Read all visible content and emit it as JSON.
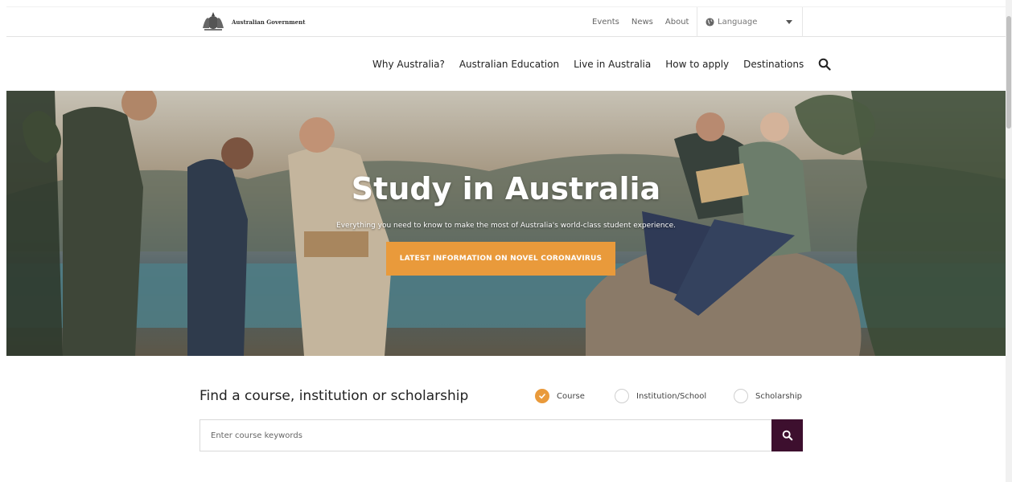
{
  "topbar": {
    "gov_name": "Australian Government",
    "links": [
      "Events",
      "News",
      "About"
    ],
    "language_label": "Language"
  },
  "nav": {
    "items": [
      "Why Australia?",
      "Australian Education",
      "Live in Australia",
      "How to apply",
      "Destinations"
    ]
  },
  "hero": {
    "title": "Study in Australia",
    "subtitle": "Everything you need to know to make the most of Australia's world-class student experience.",
    "cta_label": "LATEST INFORMATION ON NOVEL CORONAVIRUS"
  },
  "finder": {
    "title": "Find a course, institution or scholarship",
    "options": [
      {
        "label": "Course",
        "checked": true
      },
      {
        "label": "Institution/School",
        "checked": false
      },
      {
        "label": "Scholarship",
        "checked": false
      }
    ],
    "search_placeholder": "Enter course keywords"
  },
  "colors": {
    "accent": "#e99a3b",
    "search_button": "#3d0f2e"
  },
  "icons": [
    "coat-of-arms",
    "globe-icon",
    "chevron-down-icon",
    "search-icon",
    "check-icon"
  ]
}
